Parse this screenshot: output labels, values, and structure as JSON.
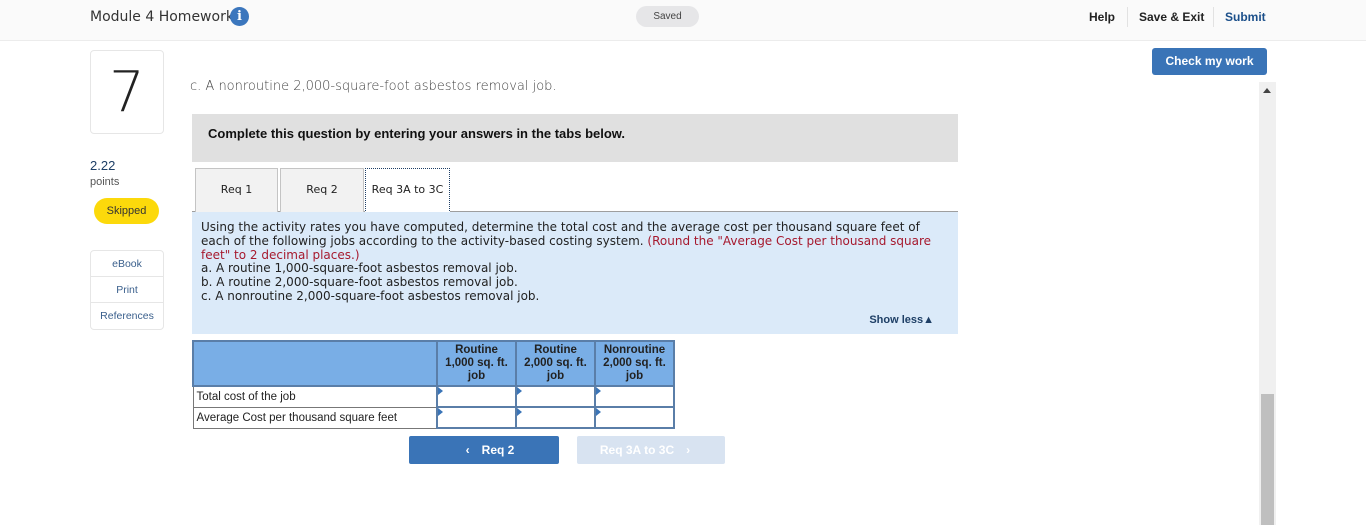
{
  "header": {
    "title": "Module 4 Homework",
    "info_icon": "info-icon",
    "status": "Saved",
    "links": {
      "help": "Help",
      "save_exit": "Save & Exit",
      "submit": "Submit"
    }
  },
  "actions": {
    "check_my_work": "Check my work"
  },
  "question": {
    "number": "7",
    "points_value": "2.22",
    "points_label": "points",
    "status_badge": "Skipped",
    "text": "c. A nonroutine 2,000-square-foot asbestos removal job."
  },
  "sidebar": {
    "items": [
      {
        "label": "eBook"
      },
      {
        "label": "Print"
      },
      {
        "label": "References"
      }
    ]
  },
  "instructions": "Complete this question by entering your answers in the tabs below.",
  "tabs": [
    {
      "label": "Req 1",
      "active": false
    },
    {
      "label": "Req 2",
      "active": false
    },
    {
      "label": "Req 3A to 3C",
      "active": true
    }
  ],
  "panel": {
    "text": "Using the activity rates you have computed, determine the total cost and the average cost per thousand square feet of each of the following jobs according to the activity-based costing system.",
    "note": "(Round the \"Average Cost per thousand square feet\" to 2 decimal places.)",
    "items": [
      "a. A routine 1,000-square-foot asbestos removal job.",
      "b. A routine 2,000-square-foot asbestos removal job.",
      "c. A nonroutine 2,000-square-foot asbestos removal job."
    ],
    "show_less": "Show less"
  },
  "table": {
    "columns": [
      {
        "line1": "Routine",
        "line2": "1,000 sq. ft.",
        "line3": "job"
      },
      {
        "line1": "Routine",
        "line2": "2,000 sq. ft.",
        "line3": "job"
      },
      {
        "line1": "Nonroutine",
        "line2": "2,000 sq. ft.",
        "line3": "job"
      }
    ],
    "rows": [
      {
        "label": "Total cost of the job",
        "values": [
          "",
          "",
          ""
        ]
      },
      {
        "label": "Average Cost per thousand square feet",
        "values": [
          "",
          "",
          ""
        ]
      }
    ]
  },
  "navigation": {
    "prev_label": "Req 2",
    "next_label": "Req 3A to 3C",
    "prev_icon": "‹",
    "next_icon": "›"
  },
  "colors": {
    "accent": "#3a74b7",
    "badge_skipped": "#fcd90b",
    "table_header": "#79aee6",
    "panel_bg": "#dbeaf9",
    "note_red": "#a6192e"
  }
}
